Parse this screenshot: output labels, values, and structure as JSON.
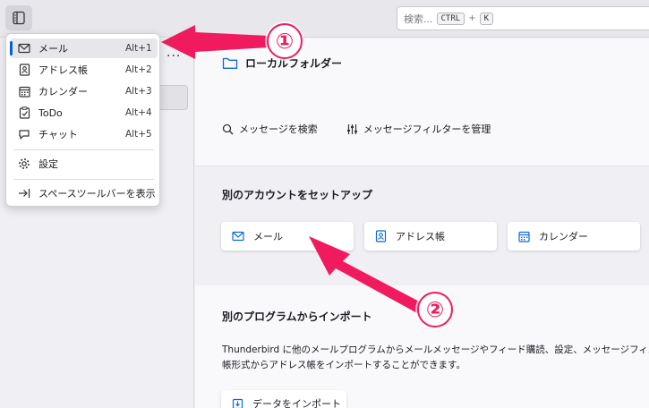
{
  "topbar": {
    "search_placeholder": "検索...",
    "shortcut_key1": "CTRL",
    "shortcut_plus": "+",
    "shortcut_key2": "K"
  },
  "leftpane": {
    "more_label": "···"
  },
  "spaces_menu": {
    "items": [
      {
        "label": "メール",
        "shortcut": "Alt+1",
        "icon": "mail-icon",
        "selected": true
      },
      {
        "label": "アドレス帳",
        "shortcut": "Alt+2",
        "icon": "address-book-icon"
      },
      {
        "label": "カレンダー",
        "shortcut": "Alt+3",
        "icon": "calendar-icon"
      },
      {
        "label": "ToDo",
        "shortcut": "Alt+4",
        "icon": "todo-icon"
      },
      {
        "label": "チャット",
        "shortcut": "Alt+5",
        "icon": "chat-icon"
      }
    ],
    "settings_label": "設定",
    "show_spaces_toolbar_label": "スペースツールバーを表示"
  },
  "main": {
    "folder_title": "ローカルフォルダー",
    "search_messages": "メッセージを検索",
    "manage_filters": "メッセージフィルターを管理",
    "setup_heading": "別のアカウントをセットアップ",
    "setup_cards": [
      {
        "label": "メール",
        "icon": "mail-icon"
      },
      {
        "label": "アドレス帳",
        "icon": "address-book-icon"
      },
      {
        "label": "カレンダー",
        "icon": "calendar-icon"
      }
    ],
    "import_heading": "別のプログラムからインポート",
    "import_text_line1": "Thunderbird に他のメールプログラムからメールメッセージやフィード購読、設定、メッセージフィルターを、一",
    "import_text_line2": "帳形式からアドレス帳をインポートすることができます。",
    "import_button": "データをインポート"
  },
  "annotations": {
    "badge1": "①",
    "badge2": "②",
    "color": "#f01a5e"
  }
}
